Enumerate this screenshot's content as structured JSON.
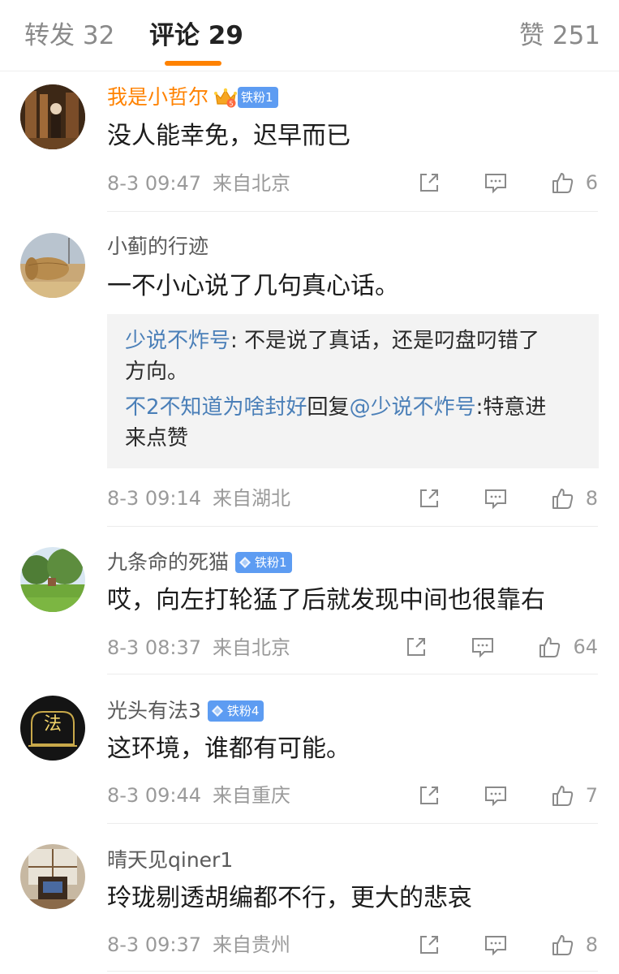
{
  "tabs": [
    {
      "label": "转发 32",
      "active": false
    },
    {
      "label": "评论 29",
      "active": true
    },
    {
      "label": "赞 251",
      "active": false
    }
  ],
  "colors": {
    "accent": "#ff8200",
    "badge": "#5d9cf2",
    "reply_name": "#4a7fb8"
  },
  "comments": [
    {
      "username": "我是小哲尔",
      "badge": "铁粉1",
      "crown_level": "5",
      "text": "没人能幸免，迟早而已",
      "time": "8-3 09:47",
      "source": "来自北京",
      "likes": "6"
    },
    {
      "username": "小蓟的行迹",
      "text": "一不小心说了几句真心话。",
      "replies": [
        {
          "name": "少说不炸号",
          "sep": ": ",
          "text_line1": "不是说了真话，还是叼盘叼错了",
          "text_line2": "方向。"
        },
        {
          "name": "不2不知道为啥封好",
          "mid": "回复",
          "target": "@少说不炸号",
          "sep": ":",
          "text_line1": "特意进",
          "text_line2": "来点赞"
        }
      ],
      "time": "8-3 09:14",
      "source": "来自湖北",
      "likes": "8"
    },
    {
      "username": "九条命的死猫",
      "badge": "铁粉1",
      "text": "哎，向左打轮猛了后就发现中间也很靠右",
      "time": "8-3 08:37",
      "source": "来自北京",
      "likes": "64"
    },
    {
      "username": "光头有法3",
      "badge": "铁粉4",
      "avatar_text": "法",
      "text": "这环境，谁都有可能。",
      "time": "8-3 09:44",
      "source": "来自重庆",
      "likes": "7"
    },
    {
      "username": "晴天见qiner1",
      "text": "玲珑剔透胡编都不行，更大的悲哀",
      "time": "8-3 09:37",
      "source": "来自贵州",
      "likes": "8"
    }
  ]
}
